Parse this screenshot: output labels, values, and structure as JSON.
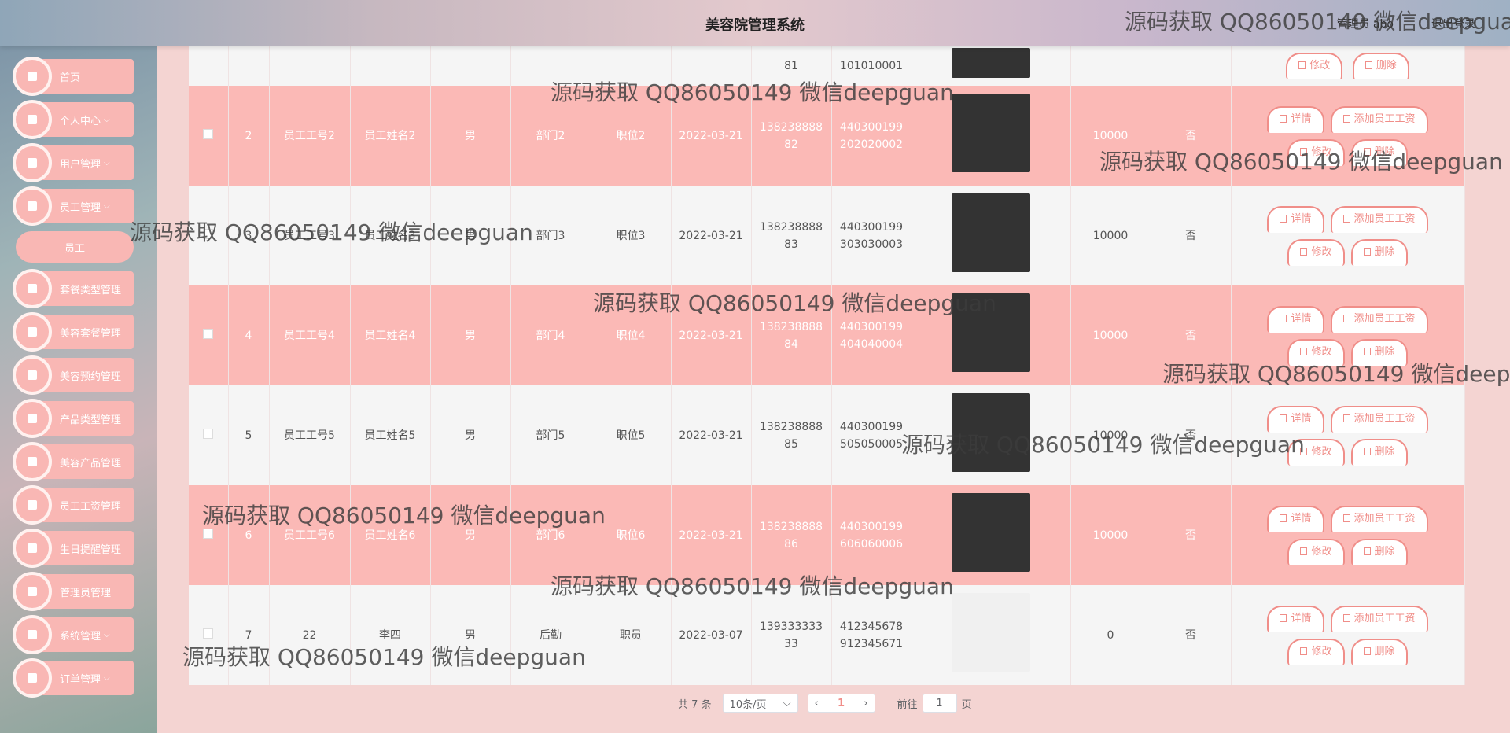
{
  "header": {
    "title": "美容院管理系统",
    "user": "管理员 abo",
    "logout": "退出登录"
  },
  "sidebar": {
    "items": [
      {
        "label": "首页",
        "chev": ""
      },
      {
        "label": "个人中心",
        "chev": "⌵"
      },
      {
        "label": "用户管理",
        "chev": "⌵"
      },
      {
        "label": "员工管理",
        "chev": "⌵"
      },
      {
        "label": "套餐类型管理",
        "chev": ""
      },
      {
        "label": "美容套餐管理",
        "chev": ""
      },
      {
        "label": "美容预约管理",
        "chev": ""
      },
      {
        "label": "产品类型管理",
        "chev": ""
      },
      {
        "label": "美容产品管理",
        "chev": ""
      },
      {
        "label": "员工工资管理",
        "chev": ""
      },
      {
        "label": "生日提醒管理",
        "chev": ""
      },
      {
        "label": "管理员管理",
        "chev": ""
      },
      {
        "label": "系统管理",
        "chev": "⌵"
      },
      {
        "label": "订单管理",
        "chev": "⌵"
      }
    ],
    "sub_item": "员工"
  },
  "table": {
    "first_row": {
      "phone_tail": "81",
      "id_tail": "101010001",
      "edit": "修改",
      "delete": "删除"
    },
    "rows": [
      {
        "idx": "2",
        "code": "员工工号2",
        "name": "员工姓名2",
        "gender": "男",
        "dept": "部门2",
        "pos": "职位2",
        "date": "2022-03-21",
        "phone1": "138238888",
        "phone2": "82",
        "id1": "440300199",
        "id2": "202020002",
        "salary": "10000",
        "flag": "否"
      },
      {
        "idx": "3",
        "code": "员工工号3",
        "name": "员工姓名3",
        "gender": "男",
        "dept": "部门3",
        "pos": "职位3",
        "date": "2022-03-21",
        "phone1": "138238888",
        "phone2": "83",
        "id1": "440300199",
        "id2": "303030003",
        "salary": "10000",
        "flag": "否"
      },
      {
        "idx": "4",
        "code": "员工工号4",
        "name": "员工姓名4",
        "gender": "男",
        "dept": "部门4",
        "pos": "职位4",
        "date": "2022-03-21",
        "phone1": "138238888",
        "phone2": "84",
        "id1": "440300199",
        "id2": "404040004",
        "salary": "10000",
        "flag": "否"
      },
      {
        "idx": "5",
        "code": "员工工号5",
        "name": "员工姓名5",
        "gender": "男",
        "dept": "部门5",
        "pos": "职位5",
        "date": "2022-03-21",
        "phone1": "138238888",
        "phone2": "85",
        "id1": "440300199",
        "id2": "505050005",
        "salary": "10000",
        "flag": "否"
      },
      {
        "idx": "6",
        "code": "员工工号6",
        "name": "员工姓名6",
        "gender": "男",
        "dept": "部门6",
        "pos": "职位6",
        "date": "2022-03-21",
        "phone1": "138238888",
        "phone2": "86",
        "id1": "440300199",
        "id2": "606060006",
        "salary": "10000",
        "flag": "否"
      },
      {
        "idx": "7",
        "code": "22",
        "name": "李四",
        "gender": "男",
        "dept": "后勤",
        "pos": "职员",
        "date": "2022-03-07",
        "phone1": "139333333",
        "phone2": "33",
        "id1": "412345678",
        "id2": "912345671",
        "salary": "0",
        "flag": "否"
      }
    ],
    "actions": {
      "detail": "详情",
      "add_salary": "添加员工工资",
      "edit": "修改",
      "delete": "删除"
    }
  },
  "pagination": {
    "total": "共 7 条",
    "page_size": "10条/页",
    "current_page": "1",
    "goto_label": "前往",
    "goto_value": "1",
    "page_suffix": "页"
  },
  "watermark": "源码获取 QQ86050149 微信deepguan"
}
